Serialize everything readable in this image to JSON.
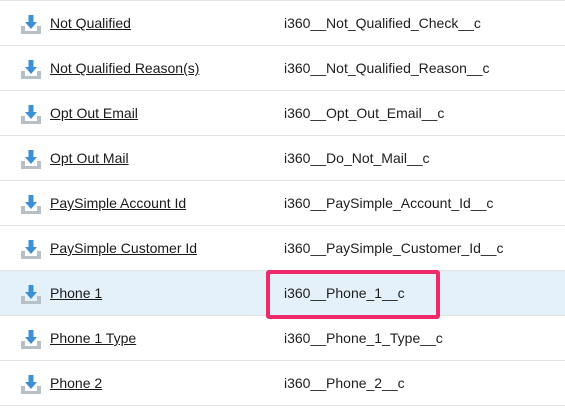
{
  "colors": {
    "highlight_row": "#e4f1fa",
    "highlight_border": "#ee2a6a",
    "icon_arrow": "#3e90d6",
    "icon_tray": "#b7bfc7"
  },
  "icon": "download-arrow-icon",
  "fields": [
    {
      "label": "Not Qualified",
      "api_name": "i360__Not_Qualified_Check__c"
    },
    {
      "label": "Not Qualified Reason(s)",
      "api_name": "i360__Not_Qualified_Reason__c"
    },
    {
      "label": "Opt Out Email",
      "api_name": "i360__Opt_Out_Email__c"
    },
    {
      "label": "Opt Out Mail",
      "api_name": "i360__Do_Not_Mail__c"
    },
    {
      "label": "PaySimple Account Id",
      "api_name": "i360__PaySimple_Account_Id__c"
    },
    {
      "label": "PaySimple Customer Id",
      "api_name": "i360__PaySimple_Customer_Id__c"
    },
    {
      "label": "Phone 1",
      "api_name": "i360__Phone_1__c"
    },
    {
      "label": "Phone 1 Type",
      "api_name": "i360__Phone_1_Type__c"
    },
    {
      "label": "Phone 2",
      "api_name": "i360__Phone_2__c"
    }
  ]
}
